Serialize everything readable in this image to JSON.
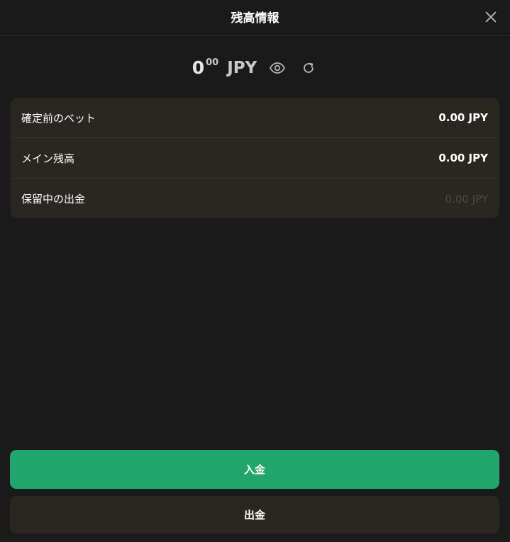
{
  "header": {
    "title": "残高情報"
  },
  "balance": {
    "integer": "0",
    "decimal": "00",
    "currency": "JPY"
  },
  "details": [
    {
      "label": "確定前のベット",
      "value": "0.00 JPY"
    },
    {
      "label": "メイン残高",
      "value": "0.00 JPY"
    },
    {
      "label": "保留中の出金",
      "value": "0.00 JPY"
    }
  ],
  "actions": {
    "deposit_label": "入金",
    "withdraw_label": "出金"
  },
  "icons": {
    "close": "close-icon",
    "visibility": "eye-icon",
    "refresh": "refresh-icon"
  },
  "colors": {
    "background": "#1a1a1a",
    "card": "#2a2723",
    "deposit": "#22a56c",
    "muted_value": "#4d4a45"
  }
}
